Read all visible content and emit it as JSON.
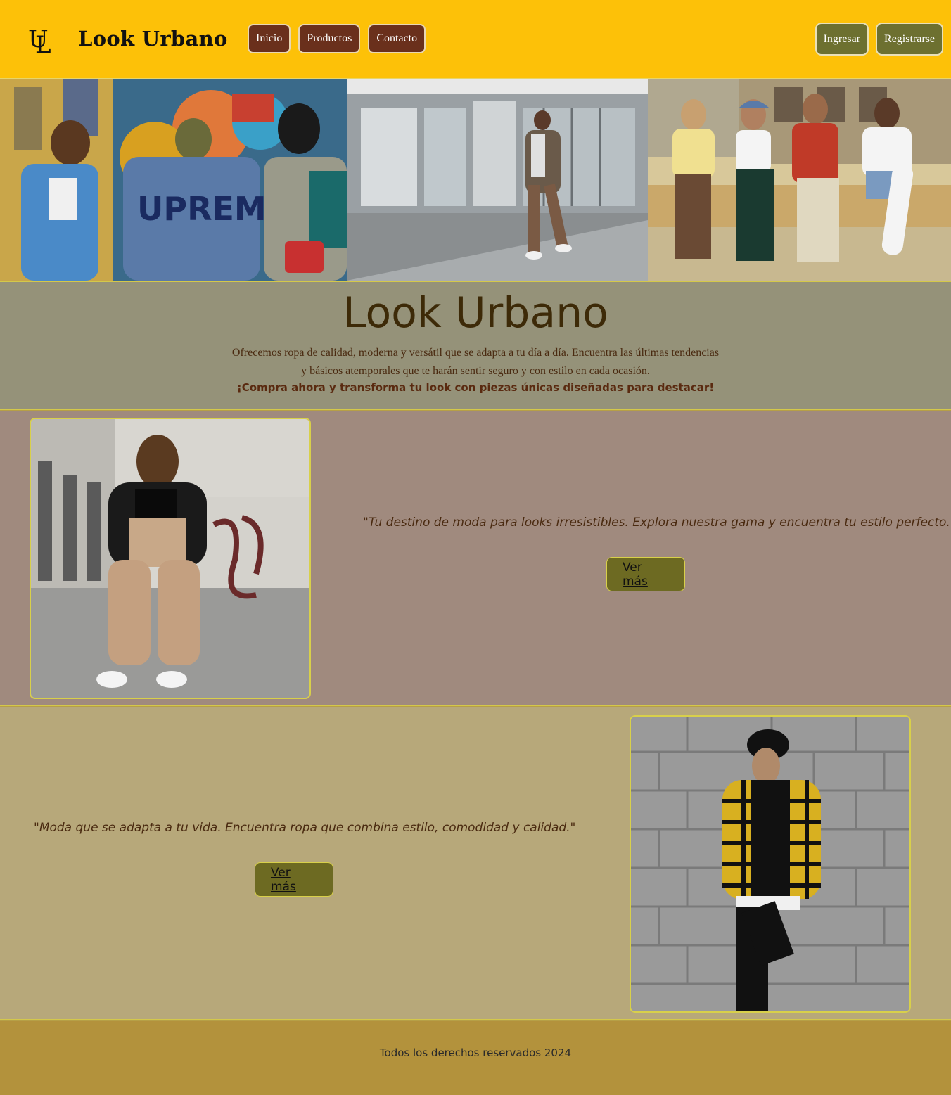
{
  "header": {
    "brand": "Look Urbano",
    "logo_letters": "UL",
    "nav": [
      {
        "label": "Inicio"
      },
      {
        "label": "Productos"
      },
      {
        "label": "Contacto"
      }
    ],
    "auth": {
      "login": "Ingresar",
      "register": "Registrarse"
    }
  },
  "hero": {
    "images": [
      "group-graffiti-photo",
      "man-walking-photo",
      "friends-sitting-photo"
    ]
  },
  "intro": {
    "title": "Look Urbano",
    "text": "Ofrecemos ropa de calidad, moderna y versátil que se adapta a tu día a día. Encuentra las últimas tendencias y básicos atemporales que te harán sentir seguro y con estilo en cada ocasión.",
    "cta": "¡Compra ahora y transforma tu look con piezas únicas diseñadas para destacar!"
  },
  "section1": {
    "quote": "\"Tu destino de moda para looks irresistibles. Explora nuestra gama y encuentra tu estilo perfecto.\"",
    "button": "Ver más"
  },
  "section2": {
    "quote": "\"Moda que se adapta a tu vida. Encuentra ropa que combina estilo, comodidad y calidad.\"",
    "button": "Ver más"
  },
  "footer": {
    "text": "Todos los derechos reservados 2024"
  },
  "colors": {
    "header_bg": "#fdc108",
    "nav_btn": "#6a301c",
    "auth_btn": "#6d7030",
    "intro_bg": "#959279",
    "sec1_bg": "#a08a7e",
    "sec2_bg": "#b7a87a",
    "footer_bg": "#b3923c"
  }
}
